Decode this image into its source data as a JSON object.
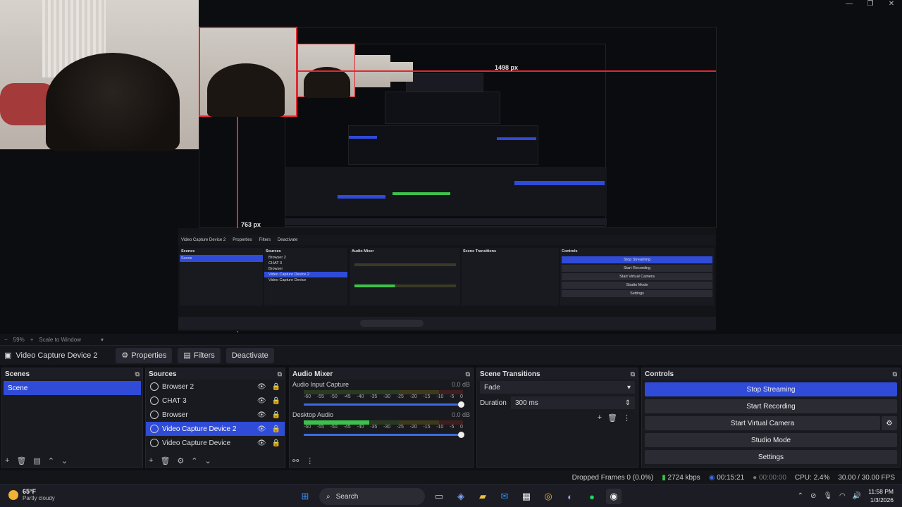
{
  "window_controls": [
    "—",
    "❐",
    "✕"
  ],
  "preview": {
    "label_width": "1498 px",
    "label_height": "763 px",
    "nested": {
      "context_source": "Video Capture Device 2",
      "context_buttons": [
        "Properties",
        "Filters",
        "Deactivate"
      ],
      "docks": [
        "Scenes",
        "Sources",
        "Audio Mixer",
        "Scene Transitions",
        "Controls"
      ],
      "scene": "Scene",
      "sources": [
        "Browser 2",
        "CHAT 3",
        "Browser",
        "Video Capture Device 2",
        "Video Capture Device"
      ],
      "controls": [
        "Stop Streaming",
        "Start Recording",
        "Start Virtual Camera",
        "Studio Mode",
        "Settings"
      ]
    }
  },
  "zoom": {
    "percent": "59%",
    "mode": "Scale to Window"
  },
  "context": {
    "source": "Video Capture Device 2",
    "properties": "Properties",
    "filters": "Filters",
    "deactivate": "Deactivate"
  },
  "scenes": {
    "title": "Scenes",
    "items": [
      "Scene"
    ],
    "selected": 0
  },
  "sources": {
    "title": "Sources",
    "items": [
      "Browser 2",
      "CHAT 3",
      "Browser",
      "Video Capture Device 2",
      "Video Capture Device"
    ],
    "selected": 3
  },
  "mixer": {
    "title": "Audio Mixer",
    "ticks": [
      "-60",
      "-55",
      "-50",
      "-45",
      "-40",
      "-35",
      "-30",
      "-25",
      "-20",
      "-15",
      "-10",
      "-5",
      "0"
    ],
    "channels": [
      {
        "name": "Audio Input Capture",
        "db": "0.0 dB",
        "level": 0.0
      },
      {
        "name": "Desktop Audio",
        "db": "0.0 dB",
        "level": 0.41
      }
    ]
  },
  "transitions": {
    "title": "Scene Transitions",
    "selected": "Fade",
    "duration_label": "Duration",
    "duration": "300 ms"
  },
  "controls": {
    "title": "Controls",
    "buttons": [
      "Stop Streaming",
      "Start Recording",
      "Start Virtual Camera",
      "Studio Mode",
      "Settings"
    ],
    "active": 0
  },
  "status": {
    "dropped": "Dropped Frames 0 (0.0%)",
    "bitrate": "2724 kbps",
    "stream_time": "00:15:21",
    "rec_time": "00:00:00",
    "cpu": "CPU: 2.4%",
    "fps": "30.00 / 30.00 FPS"
  },
  "taskbar": {
    "temp": "65°F",
    "weather": "Partly cloudy",
    "search": "Search",
    "time": "11:58 PM",
    "date": "1/3/2026"
  },
  "colors": {
    "accent": "#2f4bd8",
    "red_guide": "#e0282f",
    "meter_green": "#3bc24a"
  }
}
